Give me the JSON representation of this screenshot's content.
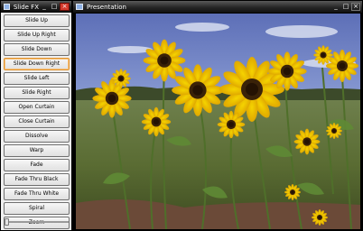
{
  "fx_window": {
    "title": "Slide FX",
    "buttons": [
      "Slide Up",
      "Slide Up Right",
      "Slide Down",
      "Slide Down Right",
      "Slide Left",
      "Slide Right",
      "Open  Curtain",
      "Close Curtain",
      "Dissolve",
      "Warp",
      "Fade",
      "Fade Thru Black",
      "Fade Thru White",
      "Spiral",
      "Zoom"
    ],
    "focused_index": 3,
    "slider_value": 0
  },
  "presentation_window": {
    "title": "Presentation"
  },
  "controls": {
    "minimize": "_",
    "maximize": "□",
    "close": "×"
  }
}
